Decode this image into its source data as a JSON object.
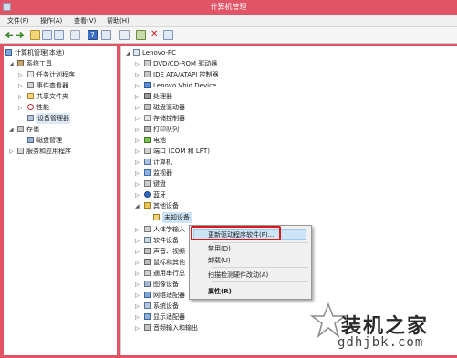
{
  "window": {
    "title": "计算机管理"
  },
  "menu": [
    {
      "label": "文件(F)"
    },
    {
      "label": "操作(A)"
    },
    {
      "label": "查看(V)"
    },
    {
      "label": "帮助(H)"
    }
  ],
  "left_tree": {
    "root": "计算机管理(本地)",
    "system_tools": "系统工具",
    "items": [
      "任务计划程序",
      "事件查看器",
      "共享文件夹",
      "性能",
      "设备管理器"
    ],
    "storage": "存储",
    "disk": "磁盘管理",
    "services": "服务和应用程序"
  },
  "device_tree": {
    "root": "Lenovo-PC",
    "items": [
      "DVD/CD-ROM 驱动器",
      "IDE ATA/ATAPI 控制器",
      "Lenovo Vhid Device",
      "处理器",
      "磁盘驱动器",
      "存储控制器",
      "打印队列",
      "电池",
      "端口 (COM 和 LPT)",
      "计算机",
      "监视器",
      "键盘",
      "蓝牙",
      "其他设备"
    ],
    "other_child": "未知设备",
    "after": [
      "人体学输入",
      "软件设备",
      "声音、视频",
      "鼠标和其他",
      "通用串行总",
      "图像设备",
      "网络适配器",
      "系统设备",
      "显示适配器",
      "音频输入和输出"
    ]
  },
  "context_menu": {
    "items": [
      "更新驱动程序软件(P)...",
      "禁用(D)",
      "卸载(U)",
      "扫描检测硬件改动(A)",
      "属性(R)"
    ]
  },
  "watermark": {
    "text": "装机之家",
    "url": "gdhjbk.com"
  },
  "colors": {
    "titlebar": "#e15466",
    "highlight_border": "#d61b1f"
  }
}
